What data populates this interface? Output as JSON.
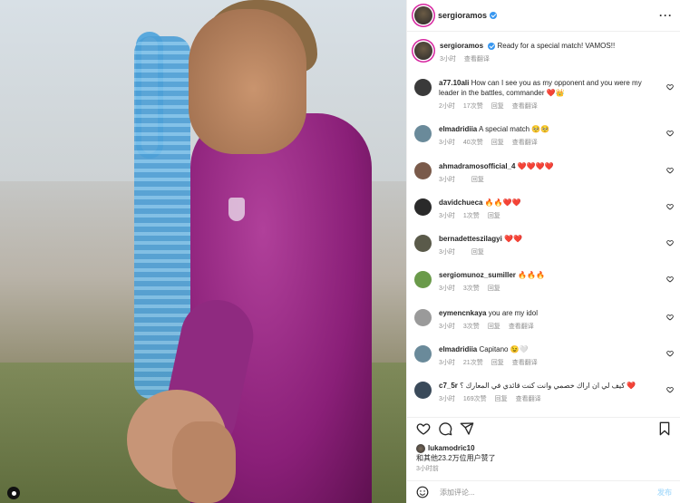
{
  "header": {
    "username": "sergioramos",
    "more_icon": "more-horizontal-icon"
  },
  "caption": {
    "username": "sergioramos",
    "text": "Ready for a special match! VAMOS!!",
    "time": "3小时",
    "translate": "查看翻译"
  },
  "comments": [
    {
      "username": "a77.10ali",
      "text": "How can I see you as my opponent and you were my leader in the battles, commander",
      "emoji": "❤️👑",
      "time": "2小时",
      "likes": "17次赞",
      "reply": "回复",
      "translate": "查看翻译"
    },
    {
      "username": "elmadridiia",
      "text": "A special match",
      "emoji": "🥺🥺",
      "time": "3小时",
      "likes": "40次赞",
      "reply": "回复",
      "translate": "查看翻译"
    },
    {
      "username": "ahmadramosofficial_4",
      "text": "",
      "emoji": "❤️❤️❤️❤️",
      "time": "3小时",
      "likes": "",
      "reply": "回复",
      "translate": ""
    },
    {
      "username": "davidchueca",
      "text": "",
      "emoji": "🔥🔥❤️❤️",
      "time": "3小时",
      "likes": "1次赞",
      "reply": "回复",
      "translate": ""
    },
    {
      "username": "bernadetteszilagyi",
      "text": "",
      "emoji": "❤️❤️",
      "time": "3小时",
      "likes": "",
      "reply": "回复",
      "translate": ""
    },
    {
      "username": "sergiomunoz_sumiller",
      "text": "",
      "emoji": "🔥🔥🔥",
      "time": "3小时",
      "likes": "3次赞",
      "reply": "回复",
      "translate": ""
    },
    {
      "username": "eymencnkaya",
      "text": "you are my idol",
      "emoji": "",
      "time": "3小时",
      "likes": "3次赞",
      "reply": "回复",
      "translate": "查看翻译"
    },
    {
      "username": "elmadridiia",
      "text": "Capitano",
      "emoji": "😉🤍",
      "time": "3小时",
      "likes": "21次赞",
      "reply": "回复",
      "translate": "查看翻译"
    },
    {
      "username": "c7_5r",
      "text": "كيف لي ان اراك خصمي وانت كنت قائدي في المعارك ؟",
      "emoji": "❤️",
      "time": "3小时",
      "likes": "169次赞",
      "reply": "回复",
      "translate": "查看翻译"
    }
  ],
  "actions": {
    "like_icon": "heart-icon",
    "comment_icon": "comment-icon",
    "share_icon": "share-icon",
    "save_icon": "bookmark-icon"
  },
  "likes_summary": {
    "username": "lukamodric10",
    "text": "和其他23.2万位用户赞了"
  },
  "post_time": "3小时前",
  "add_comment": {
    "placeholder": "添加评论...",
    "post_label": "发布",
    "emoji_icon": "smile-icon"
  },
  "colors": {
    "verified": "#3897f0",
    "heart": "#e0245e",
    "meta": "#8e8e8e"
  }
}
